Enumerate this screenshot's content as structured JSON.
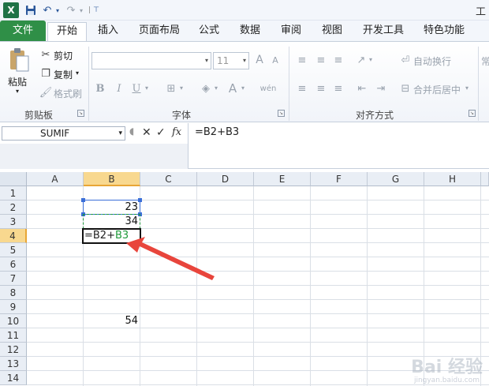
{
  "title": "工",
  "quick_access": {
    "logo": "X",
    "save_icon": "💾",
    "undo_icon": "↶",
    "redo_icon": "↷"
  },
  "tabs": [
    {
      "label": "文件"
    },
    {
      "label": "开始"
    },
    {
      "label": "插入"
    },
    {
      "label": "页面布局"
    },
    {
      "label": "公式"
    },
    {
      "label": "数据"
    },
    {
      "label": "审阅"
    },
    {
      "label": "视图"
    },
    {
      "label": "开发工具"
    },
    {
      "label": "特色功能"
    }
  ],
  "ribbon": {
    "clipboard": {
      "paste": "粘贴",
      "cut": "剪切",
      "copy": "复制",
      "format_painter": "格式刷",
      "group": "剪贴板"
    },
    "font": {
      "size": "11",
      "bold": "B",
      "italic": "I",
      "underline": "U",
      "grow": "A",
      "shrink": "A",
      "font_color": "A",
      "wen": "wén",
      "group": "字体"
    },
    "alignment": {
      "wrap": "自动换行",
      "merge": "合并后居中",
      "group": "对齐方式"
    },
    "number_partial": "常"
  },
  "formula_bar": {
    "name_box": "SUMIF",
    "cancel": "✕",
    "enter": "✓",
    "fx": "fx",
    "content": "=B2+B3"
  },
  "grid": {
    "columns": [
      "A",
      "B",
      "C",
      "D",
      "E",
      "F",
      "G",
      "H"
    ],
    "rows": [
      "1",
      "2",
      "3",
      "4",
      "5",
      "6",
      "7",
      "8",
      "9",
      "10",
      "11",
      "12",
      "13",
      "14"
    ],
    "cells": {
      "B2": "23",
      "B3": "34",
      "B4_part1": "=B2+",
      "B4_part2": "B3",
      "B10": "54"
    }
  },
  "colors": {
    "file_tab": "#2f8f47",
    "selection_blue": "#3b6fd8",
    "header_selected": "#f8d88f",
    "arrow": "#e8453c",
    "b3_ref": "#1f9a3a"
  },
  "watermark": {
    "brand": "Bai 经验",
    "url": "jingyan.baidu.com"
  }
}
